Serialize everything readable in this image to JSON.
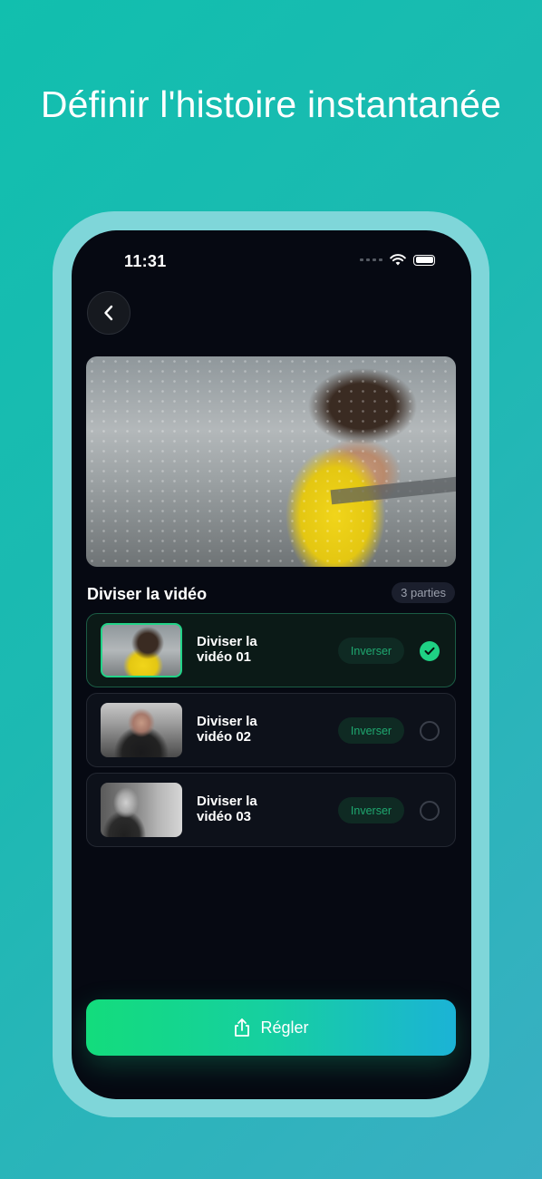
{
  "headline": "Définir l'histoire instantanée",
  "status_bar": {
    "time": "11:31",
    "icons": [
      "signal-icon",
      "wifi-icon",
      "battery-icon"
    ]
  },
  "back_button": {
    "icon": "chevron-left-icon"
  },
  "section": {
    "title": "Diviser la vidéo",
    "count": "3 parties"
  },
  "clips": [
    {
      "line1": "Diviser la",
      "line2": "vidéo 01",
      "action": "Inverser",
      "selected": true
    },
    {
      "line1": "Diviser la",
      "line2": "vidéo 02",
      "action": "Inverser",
      "selected": false
    },
    {
      "line1": "Diviser la",
      "line2": "vidéo 03",
      "action": "Inverser",
      "selected": false
    }
  ],
  "apply_button": {
    "label": "Régler",
    "icon": "share-icon"
  },
  "colors": {
    "accent": "#1fd184",
    "background_top": "#11bfae",
    "background_bottom": "#3aafc3",
    "screen": "#060912"
  }
}
